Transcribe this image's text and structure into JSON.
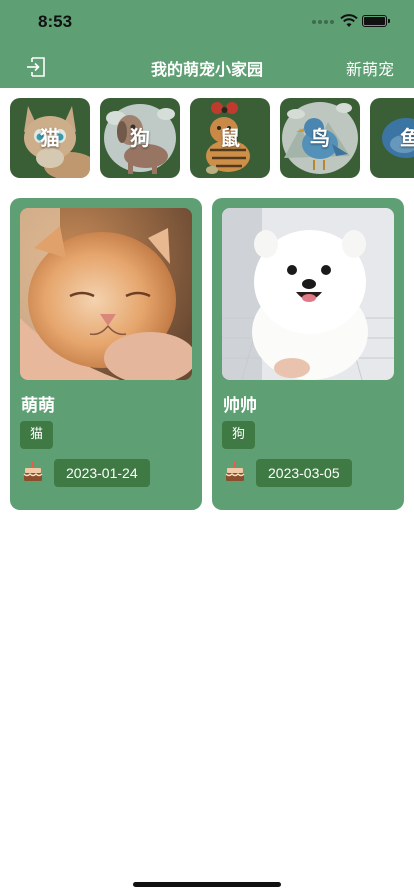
{
  "status": {
    "time": "8:53"
  },
  "nav": {
    "title": "我的萌宠小家园",
    "right_label": "新萌宠",
    "left_icon": "logout-icon"
  },
  "categories": [
    {
      "label": "猫",
      "icon": "cat-illustration"
    },
    {
      "label": "狗",
      "icon": "dog-illustration"
    },
    {
      "label": "鼠",
      "icon": "mouse-illustration"
    },
    {
      "label": "鸟",
      "icon": "bird-illustration"
    },
    {
      "label": "鱼",
      "icon": "fish-illustration"
    }
  ],
  "pets": [
    {
      "name": "萌萌",
      "type": "猫",
      "birthday": "2023-01-24",
      "photo": "kitten-photo"
    },
    {
      "name": "帅帅",
      "type": "狗",
      "birthday": "2023-03-05",
      "photo": "pomeranian-photo"
    }
  ],
  "colors": {
    "header": "#5e9f74",
    "card": "#5e9f74",
    "tag": "#3f7a44",
    "category_bg": "#3a5f37"
  }
}
